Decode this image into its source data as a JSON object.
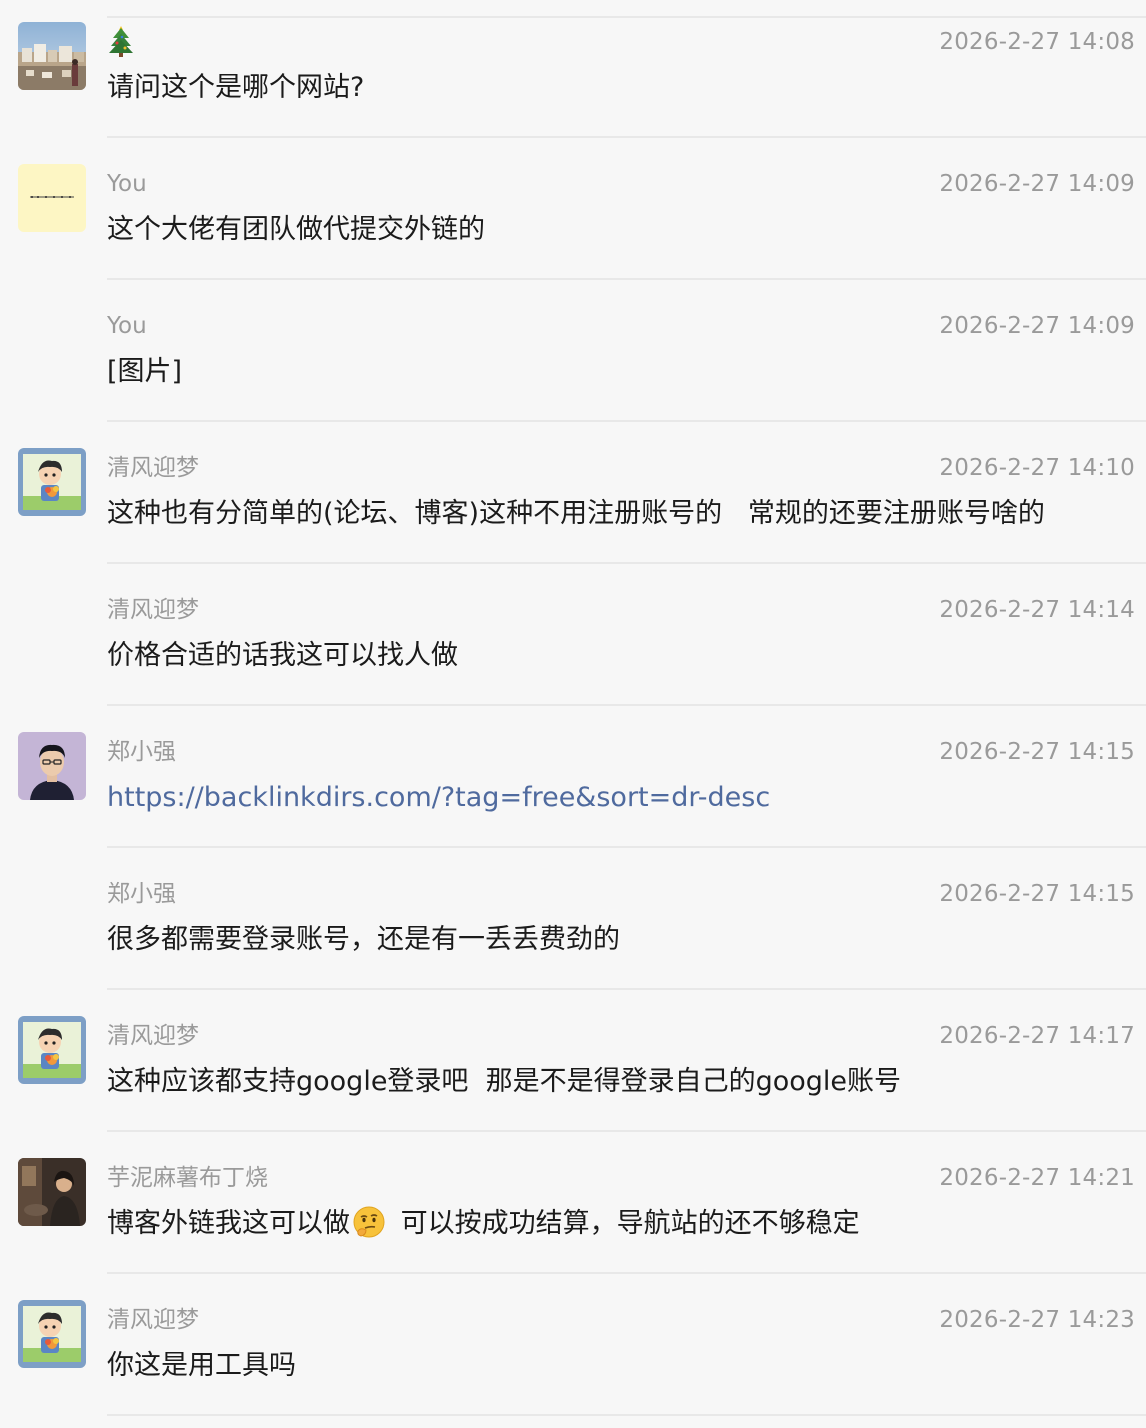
{
  "messages": [
    {
      "id": 1,
      "sender": "",
      "sender_icon": "christmas-tree-icon",
      "time": "2026-2-27 14:08",
      "text": "请问这个是哪个网站?",
      "avatar": "landscape-photo"
    },
    {
      "id": 2,
      "sender": "You",
      "time": "2026-2-27 14:09",
      "text": "这个大佬有团队做代提交外链的",
      "avatar": "yellow-note"
    },
    {
      "id": 3,
      "sender": "You",
      "time": "2026-2-27 14:09",
      "text": "[图片]",
      "avatar": ""
    },
    {
      "id": 4,
      "sender": "清风迎梦",
      "time": "2026-2-27 14:10",
      "text": "这种也有分简单的(论坛、博客)这种不用注册账号的   常规的还要注册账号啥的",
      "avatar": "cartoon-boy"
    },
    {
      "id": 5,
      "sender": "清风迎梦",
      "time": "2026-2-27 14:14",
      "text": "价格合适的话我这可以找人做",
      "avatar": ""
    },
    {
      "id": 6,
      "sender": "郑小强",
      "time": "2026-2-27 14:15",
      "text": "https://backlinkdirs.com/?tag=free&sort=dr-desc",
      "avatar": "man-photo",
      "is_link": true
    },
    {
      "id": 7,
      "sender": "郑小强",
      "time": "2026-2-27 14:15",
      "text": "很多都需要登录账号，还是有一丢丢费劲的",
      "avatar": ""
    },
    {
      "id": 8,
      "sender": "清风迎梦",
      "time": "2026-2-27 14:17",
      "text": "这种应该都支持google登录吧  那是不是得登录自己的google账号",
      "avatar": "cartoon-boy"
    },
    {
      "id": 9,
      "sender": "芋泥麻薯布丁烧",
      "time": "2026-2-27 14:21",
      "text_before": "博客外链我这可以做",
      "emoji": "thinking-face-icon",
      "text_after": " 可以按成功结算，导航站的还不够稳定",
      "avatar": "dark-photo"
    },
    {
      "id": 10,
      "sender": "清风迎梦",
      "time": "2026-2-27 14:23",
      "text": "你这是用工具吗",
      "avatar": "cartoon-boy"
    }
  ],
  "colors": {
    "background": "#f7f7f7",
    "meta_text": "#9a9a9a",
    "body_text": "#1b1b1b",
    "link": "#4f6a9e",
    "divider": "#e8e8e8"
  }
}
